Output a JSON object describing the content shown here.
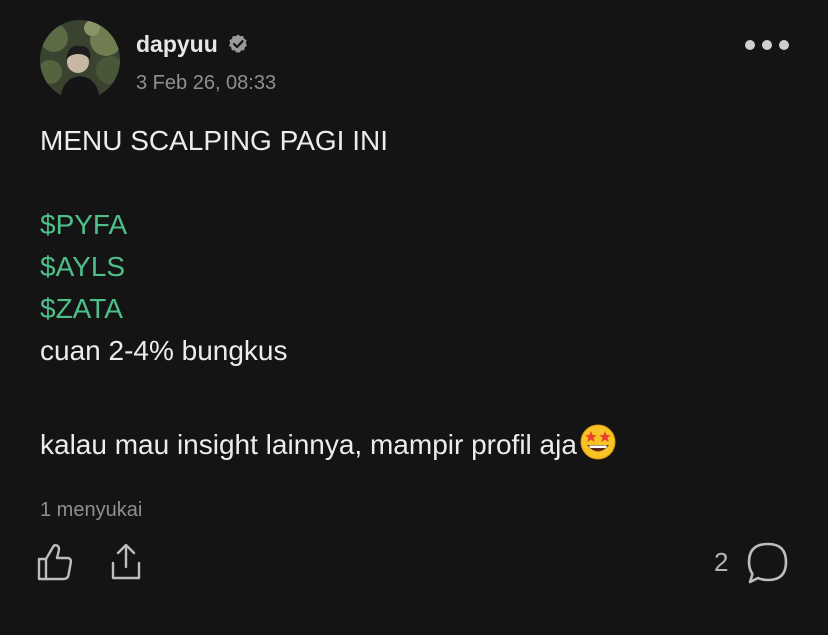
{
  "post": {
    "author": {
      "username": "dapyuu",
      "verified_icon": "verified-check-icon",
      "avatar_icon": "avatar-photo"
    },
    "timestamp": "3 Feb 26, 08:33",
    "more_icon": "more-options-icon",
    "content": {
      "title": "MENU SCALPING PAGI INI",
      "tickers": [
        "$PYFA",
        "$AYLS",
        "$ZATA"
      ],
      "note": "cuan 2-4% bungkus",
      "closing": "kalau mau insight lainnya, mampir profil aja",
      "closing_emoji": "star-struck-emoji"
    },
    "likes_text": "1 menyukai",
    "actions": {
      "like_icon": "thumbs-up-icon",
      "share_icon": "share-icon",
      "comment_count": "2",
      "comment_icon": "comment-bubble-icon"
    },
    "colors": {
      "background": "#141414",
      "ticker": "#4fbf8a",
      "text": "#ececec",
      "muted": "#8f8f8f"
    }
  }
}
